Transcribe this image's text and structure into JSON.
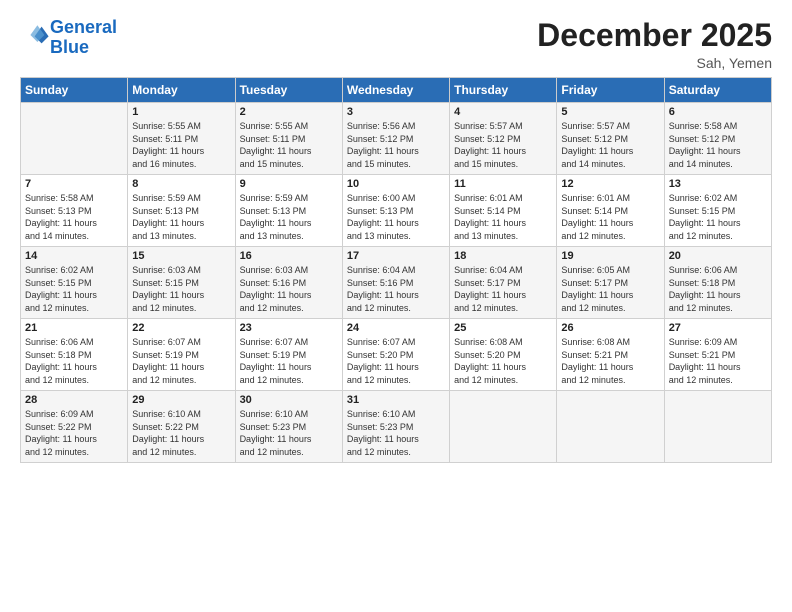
{
  "header": {
    "logo_line1": "General",
    "logo_line2": "Blue",
    "month": "December 2025",
    "location": "Sah, Yemen"
  },
  "weekdays": [
    "Sunday",
    "Monday",
    "Tuesday",
    "Wednesday",
    "Thursday",
    "Friday",
    "Saturday"
  ],
  "weeks": [
    [
      {
        "day": "",
        "sunrise": "",
        "sunset": "",
        "daylight": ""
      },
      {
        "day": "1",
        "sunrise": "Sunrise: 5:55 AM",
        "sunset": "Sunset: 5:11 PM",
        "daylight": "Daylight: 11 hours and 16 minutes."
      },
      {
        "day": "2",
        "sunrise": "Sunrise: 5:55 AM",
        "sunset": "Sunset: 5:11 PM",
        "daylight": "Daylight: 11 hours and 15 minutes."
      },
      {
        "day": "3",
        "sunrise": "Sunrise: 5:56 AM",
        "sunset": "Sunset: 5:12 PM",
        "daylight": "Daylight: 11 hours and 15 minutes."
      },
      {
        "day": "4",
        "sunrise": "Sunrise: 5:57 AM",
        "sunset": "Sunset: 5:12 PM",
        "daylight": "Daylight: 11 hours and 15 minutes."
      },
      {
        "day": "5",
        "sunrise": "Sunrise: 5:57 AM",
        "sunset": "Sunset: 5:12 PM",
        "daylight": "Daylight: 11 hours and 14 minutes."
      },
      {
        "day": "6",
        "sunrise": "Sunrise: 5:58 AM",
        "sunset": "Sunset: 5:12 PM",
        "daylight": "Daylight: 11 hours and 14 minutes."
      }
    ],
    [
      {
        "day": "7",
        "sunrise": "Sunrise: 5:58 AM",
        "sunset": "Sunset: 5:13 PM",
        "daylight": "Daylight: 11 hours and 14 minutes."
      },
      {
        "day": "8",
        "sunrise": "Sunrise: 5:59 AM",
        "sunset": "Sunset: 5:13 PM",
        "daylight": "Daylight: 11 hours and 13 minutes."
      },
      {
        "day": "9",
        "sunrise": "Sunrise: 5:59 AM",
        "sunset": "Sunset: 5:13 PM",
        "daylight": "Daylight: 11 hours and 13 minutes."
      },
      {
        "day": "10",
        "sunrise": "Sunrise: 6:00 AM",
        "sunset": "Sunset: 5:13 PM",
        "daylight": "Daylight: 11 hours and 13 minutes."
      },
      {
        "day": "11",
        "sunrise": "Sunrise: 6:01 AM",
        "sunset": "Sunset: 5:14 PM",
        "daylight": "Daylight: 11 hours and 13 minutes."
      },
      {
        "day": "12",
        "sunrise": "Sunrise: 6:01 AM",
        "sunset": "Sunset: 5:14 PM",
        "daylight": "Daylight: 11 hours and 12 minutes."
      },
      {
        "day": "13",
        "sunrise": "Sunrise: 6:02 AM",
        "sunset": "Sunset: 5:15 PM",
        "daylight": "Daylight: 11 hours and 12 minutes."
      }
    ],
    [
      {
        "day": "14",
        "sunrise": "Sunrise: 6:02 AM",
        "sunset": "Sunset: 5:15 PM",
        "daylight": "Daylight: 11 hours and 12 minutes."
      },
      {
        "day": "15",
        "sunrise": "Sunrise: 6:03 AM",
        "sunset": "Sunset: 5:15 PM",
        "daylight": "Daylight: 11 hours and 12 minutes."
      },
      {
        "day": "16",
        "sunrise": "Sunrise: 6:03 AM",
        "sunset": "Sunset: 5:16 PM",
        "daylight": "Daylight: 11 hours and 12 minutes."
      },
      {
        "day": "17",
        "sunrise": "Sunrise: 6:04 AM",
        "sunset": "Sunset: 5:16 PM",
        "daylight": "Daylight: 11 hours and 12 minutes."
      },
      {
        "day": "18",
        "sunrise": "Sunrise: 6:04 AM",
        "sunset": "Sunset: 5:17 PM",
        "daylight": "Daylight: 11 hours and 12 minutes."
      },
      {
        "day": "19",
        "sunrise": "Sunrise: 6:05 AM",
        "sunset": "Sunset: 5:17 PM",
        "daylight": "Daylight: 11 hours and 12 minutes."
      },
      {
        "day": "20",
        "sunrise": "Sunrise: 6:06 AM",
        "sunset": "Sunset: 5:18 PM",
        "daylight": "Daylight: 11 hours and 12 minutes."
      }
    ],
    [
      {
        "day": "21",
        "sunrise": "Sunrise: 6:06 AM",
        "sunset": "Sunset: 5:18 PM",
        "daylight": "Daylight: 11 hours and 12 minutes."
      },
      {
        "day": "22",
        "sunrise": "Sunrise: 6:07 AM",
        "sunset": "Sunset: 5:19 PM",
        "daylight": "Daylight: 11 hours and 12 minutes."
      },
      {
        "day": "23",
        "sunrise": "Sunrise: 6:07 AM",
        "sunset": "Sunset: 5:19 PM",
        "daylight": "Daylight: 11 hours and 12 minutes."
      },
      {
        "day": "24",
        "sunrise": "Sunrise: 6:07 AM",
        "sunset": "Sunset: 5:20 PM",
        "daylight": "Daylight: 11 hours and 12 minutes."
      },
      {
        "day": "25",
        "sunrise": "Sunrise: 6:08 AM",
        "sunset": "Sunset: 5:20 PM",
        "daylight": "Daylight: 11 hours and 12 minutes."
      },
      {
        "day": "26",
        "sunrise": "Sunrise: 6:08 AM",
        "sunset": "Sunset: 5:21 PM",
        "daylight": "Daylight: 11 hours and 12 minutes."
      },
      {
        "day": "27",
        "sunrise": "Sunrise: 6:09 AM",
        "sunset": "Sunset: 5:21 PM",
        "daylight": "Daylight: 11 hours and 12 minutes."
      }
    ],
    [
      {
        "day": "28",
        "sunrise": "Sunrise: 6:09 AM",
        "sunset": "Sunset: 5:22 PM",
        "daylight": "Daylight: 11 hours and 12 minutes."
      },
      {
        "day": "29",
        "sunrise": "Sunrise: 6:10 AM",
        "sunset": "Sunset: 5:22 PM",
        "daylight": "Daylight: 11 hours and 12 minutes."
      },
      {
        "day": "30",
        "sunrise": "Sunrise: 6:10 AM",
        "sunset": "Sunset: 5:23 PM",
        "daylight": "Daylight: 11 hours and 12 minutes."
      },
      {
        "day": "31",
        "sunrise": "Sunrise: 6:10 AM",
        "sunset": "Sunset: 5:23 PM",
        "daylight": "Daylight: 11 hours and 12 minutes."
      },
      {
        "day": "",
        "sunrise": "",
        "sunset": "",
        "daylight": ""
      },
      {
        "day": "",
        "sunrise": "",
        "sunset": "",
        "daylight": ""
      },
      {
        "day": "",
        "sunrise": "",
        "sunset": "",
        "daylight": ""
      }
    ]
  ]
}
